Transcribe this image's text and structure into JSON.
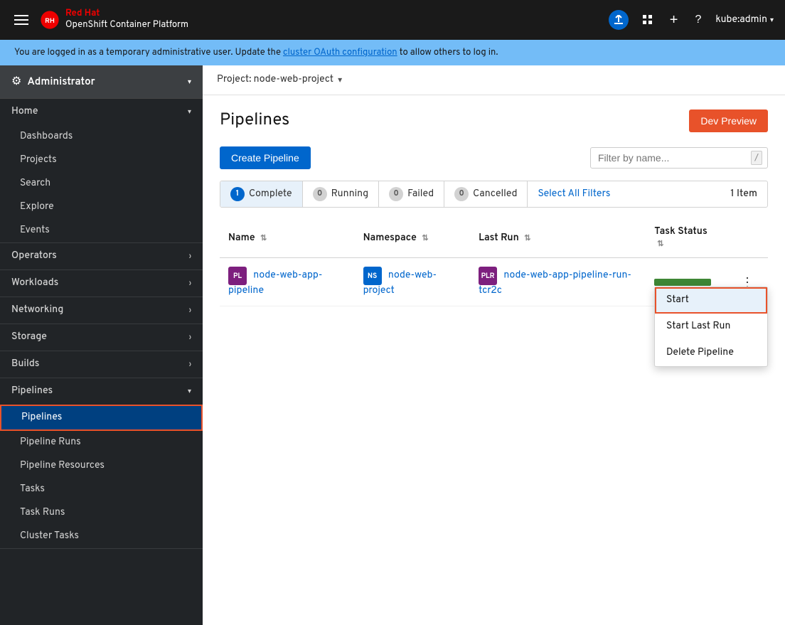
{
  "topNav": {
    "hamburger_label": "Toggle navigation",
    "brand": {
      "redhat": "Red Hat",
      "ocp": "OpenShift Container Platform"
    },
    "uploadIcon": "↑",
    "gridIcon": "grid",
    "addIcon": "+",
    "helpIcon": "?",
    "user": "kube:admin",
    "chevron": "▾"
  },
  "infoBanner": {
    "text": "You are logged in as a temporary administrative user. Update the ",
    "linkText": "cluster OAuth configuration",
    "textAfter": " to allow others to log in."
  },
  "sidebar": {
    "adminLabel": "Administrator",
    "chevron": "▾",
    "sections": [
      {
        "label": "Home",
        "expanded": true,
        "items": [
          "Dashboards",
          "Projects",
          "Search",
          "Explore",
          "Events"
        ]
      },
      {
        "label": "Operators",
        "expanded": false,
        "items": []
      },
      {
        "label": "Workloads",
        "expanded": false,
        "items": []
      },
      {
        "label": "Networking",
        "expanded": false,
        "items": []
      },
      {
        "label": "Storage",
        "expanded": false,
        "items": []
      },
      {
        "label": "Builds",
        "expanded": false,
        "items": []
      },
      {
        "label": "Pipelines",
        "expanded": true,
        "items": [
          "Pipelines",
          "Pipeline Runs",
          "Pipeline Resources",
          "Tasks",
          "Task Runs",
          "Cluster Tasks"
        ]
      }
    ]
  },
  "projectSelector": {
    "label": "Project: node-web-project",
    "chevron": "▾"
  },
  "page": {
    "title": "Pipelines",
    "devPreviewBtn": "Dev Preview"
  },
  "toolbar": {
    "createBtn": "Create Pipeline",
    "filterPlaceholder": "Filter by name...",
    "filterSlash": "/"
  },
  "filterTabs": {
    "complete": {
      "label": "Complete",
      "count": "1"
    },
    "running": {
      "label": "Running",
      "count": "0"
    },
    "failed": {
      "label": "Failed",
      "count": "0"
    },
    "cancelled": {
      "label": "Cancelled",
      "count": "0"
    },
    "selectAll": "Select All Filters",
    "itemCount": "1 Item"
  },
  "table": {
    "columns": [
      {
        "label": "Name"
      },
      {
        "label": "Namespace"
      },
      {
        "label": "Last Run"
      },
      {
        "label": "Task Status"
      }
    ],
    "rows": [
      {
        "nameBadge": "PL",
        "nameLink": "node-web-app-pipeline",
        "nsBadge": "NS",
        "nsLink": "node-web-project",
        "lastRunBadge": "PLR",
        "lastRunLink": "node-web-app-pipeline-run-tcr2c"
      }
    ]
  },
  "contextMenu": {
    "items": [
      "Start",
      "Start Last Run",
      "Delete Pipeline"
    ],
    "startHighlighted": true
  }
}
